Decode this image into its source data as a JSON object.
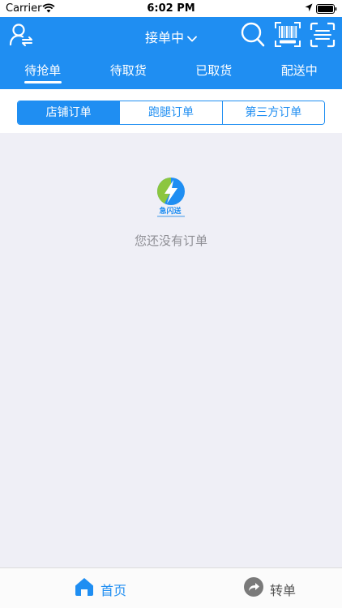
{
  "status_bar": {
    "carrier": "Carrier",
    "time": "6:02 PM"
  },
  "header": {
    "title": "接单中",
    "user_icon": "user-switch-icon",
    "search_icon": "search-icon",
    "barcode_icon": "barcode-scan-icon",
    "scan_icon": "scan-frame-icon",
    "background": "#1f8ef2"
  },
  "tabs": [
    {
      "label": "待抢单",
      "active": true
    },
    {
      "label": "待取货",
      "active": false
    },
    {
      "label": "已取货",
      "active": false
    },
    {
      "label": "配送中",
      "active": false
    }
  ],
  "segments": [
    {
      "label": "店铺订单",
      "active": true
    },
    {
      "label": "跑腿订单",
      "active": false
    },
    {
      "label": "第三方订单",
      "active": false
    }
  ],
  "empty_state": {
    "logo_text": "急闪送",
    "message": "您还没有订单"
  },
  "tabbar": {
    "home_label": "首页",
    "transfer_label": "转单",
    "active_color": "#1f8ef2"
  }
}
